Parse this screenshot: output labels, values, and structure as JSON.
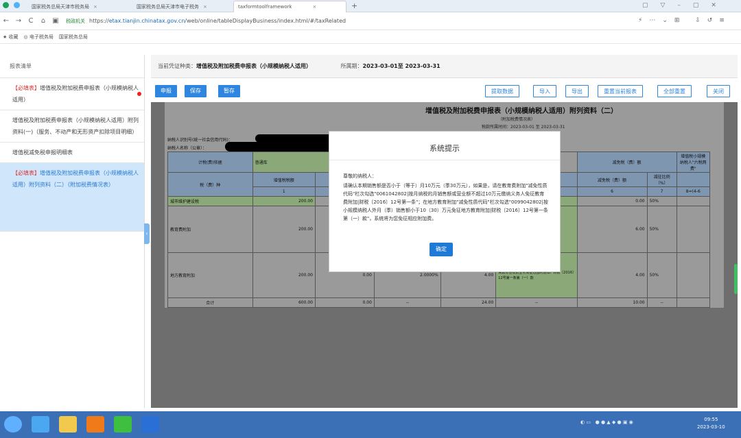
{
  "browser": {
    "tabs": [
      {
        "label": "国家税务总局天津市税务局"
      },
      {
        "label": "国家税务总局天津市电子税务"
      },
      {
        "label": "taxformtoolframework"
      }
    ],
    "url_prefix": "https://",
    "url_host": "etax.tianjin.chinatax.gov.cn",
    "url_path": "/web/online/tableDisplayBusiness/index.html/#/taxRelated",
    "security_label": "税政机关",
    "bookmarks": [
      "★ 收藏",
      "◎ 电子税务局",
      "国家税务总局"
    ]
  },
  "sidebar": {
    "title": "报表清单",
    "items": [
      {
        "req": "【必填表】",
        "label": "增值税及附加税费申报表（小规模纳税人适用）"
      },
      {
        "req": "",
        "label": "增值税及附加税费申报表（小规模纳税人适用）附列资料(一)（服务、不动产和无形资产扣除项目明细）"
      },
      {
        "req": "",
        "label": "增值税减免税申报明细表"
      },
      {
        "req": "【必填表】",
        "label": "增值税及附加税费申报表（小规模纳税人适用）附列资料（二）（附加税费情况表）"
      }
    ]
  },
  "header": {
    "voucher_type_label": "当前凭证种类：",
    "voucher_type": "增值税及附加税费申报表（小规模纳税人适用）",
    "period_label": "所属期：",
    "period": "2023-03-01至 2023-03-31"
  },
  "toolbar": {
    "left": [
      "申报",
      "保存",
      "暂存"
    ],
    "right": [
      "提取数据",
      "导入",
      "导出",
      "重置当前报表",
      "全部重置",
      "关闭"
    ]
  },
  "sheet": {
    "title": "增值税及附加税费申报表（小规模纳税人适用）附列资料（二）",
    "subtitle": "（附加税费情况表）",
    "period": "税款所属时间：2023-03-01 至 2023-03-31",
    "taxpayer_id_label": "纳税人识别号(统一社会信用代码)：",
    "taxpayer_name_label": "纳税人名称（公章）：",
    "basis_label": "计税(费)依据",
    "basis_value": "普通库",
    "col_tax": "税（费）种",
    "col_vat": "增值税税额",
    "reduction_header": "减免税（费）额",
    "small_header": "增值税小规模纳税人\"六税两费\"",
    "reduction_amount": "减免税（费）额",
    "reduction_ratio": "减征比例（%）",
    "col_num_1": "1",
    "col_num_6": "6",
    "col_num_7": "7",
    "col_num_8": "8=(4-6",
    "rows": [
      {
        "name": "城市维护建设税",
        "vat": "200.00",
        "reduct": "0.00",
        "ratio": "50%"
      },
      {
        "name": "教育费附加",
        "vat": "200.00",
        "reduct": "6.00",
        "ratio": "50%"
      },
      {
        "name": "地方教育附加",
        "vat": "200.00",
        "c3": "0.00",
        "c4": "2.0000%",
        "c5": "4.00",
        "note": "关教育性收费业务免征范围的通知》财税〔2016〕12号第一条第（一）款",
        "reduct": "4.00",
        "ratio": "50%"
      },
      {
        "name": "合计",
        "vat": "600.00",
        "c3": "0.00",
        "c4": "--",
        "c5": "24.00",
        "note": "--",
        "reduct": "10.00",
        "ratio": "--"
      }
    ]
  },
  "modal": {
    "title": "系统提示",
    "greeting": "尊敬的纳税人：",
    "body": "请确认本期销售额是否小于（等于）月10万元（季30万元），如果是，请在教育费附加\"减免性质代码\"栏次勾选\"0061042802|按月纳税的月销售额或营业额不超过10万元缴纳义务人免征教育费附加|财税〔2016〕12号第一条\"；在地方教育附加\"减免性质代码\"栏次勾选\"0099042802|按小规模纳税人外月（季）销售额小于10（30）万元免征地方教育附加|财税〔2016〕12号第一条第（一）款\"，系统将为您免征相应附加费。",
    "ok": "确定"
  },
  "taskbar": {
    "time": "09:55",
    "date": "2023-03-10"
  }
}
